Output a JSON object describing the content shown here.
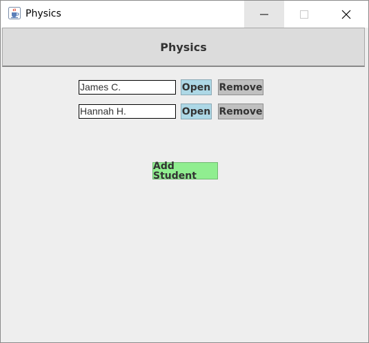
{
  "window": {
    "title": "Physics",
    "app_icon": "java-cup-icon",
    "controls": {
      "minimize_icon": "minimize-icon",
      "maximize_icon": "maximize-icon",
      "close_icon": "close-icon"
    }
  },
  "header": {
    "title": "Physics"
  },
  "students": [
    {
      "name": "James C.",
      "open_label": "Open",
      "remove_label": "Remove"
    },
    {
      "name": "Hannah H.",
      "open_label": "Open",
      "remove_label": "Remove"
    }
  ],
  "actions": {
    "add_student_label": "Add Student"
  },
  "colors": {
    "background": "#eeeeee",
    "header_background": "#dcdcdc",
    "open_button": "#add8e6",
    "remove_button": "#c0c0c0",
    "add_button": "#90ee90",
    "text": "#333333"
  }
}
